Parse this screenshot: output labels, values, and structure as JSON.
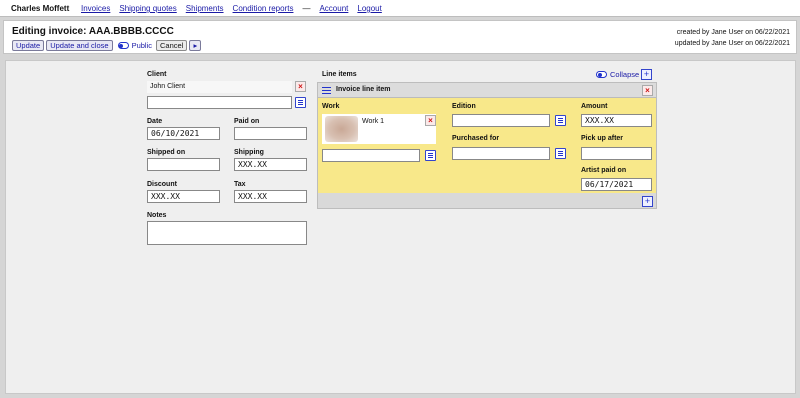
{
  "topbar": {
    "brand": "Charles Moffett",
    "nav": [
      "Invoices",
      "Shipping quotes",
      "Shipments",
      "Condition reports"
    ],
    "separator": "—",
    "nav_right": [
      "Account",
      "Logout"
    ]
  },
  "header": {
    "title": "Editing invoice: AAA.BBBB.CCCC",
    "buttons": {
      "update": "Update",
      "update_close": "Update and close",
      "public": "Public",
      "cancel": "Cancel",
      "arrow": "▸"
    },
    "created": "created by Jane User on 06/22/2021",
    "updated": "updated by Jane User on 06/22/2021"
  },
  "form": {
    "client_label": "Client",
    "client_value": "John Client",
    "client_search_value": "",
    "date_label": "Date",
    "date_value": "06/10/2021",
    "paid_on_label": "Paid on",
    "paid_on_value": "",
    "shipped_on_label": "Shipped on",
    "shipped_on_value": "",
    "shipping_label": "Shipping",
    "shipping_value": "XXX.XX",
    "discount_label": "Discount",
    "discount_value": "XXX.XX",
    "tax_label": "Tax",
    "tax_value": "XXX.XX",
    "notes_label": "Notes",
    "notes_value": ""
  },
  "line_items": {
    "label": "Line items",
    "collapse_label": "Collapse",
    "item_title": "Invoice line item",
    "work_label": "Work",
    "work_name": "Work 1",
    "edition_label": "Edition",
    "edition_value": "",
    "purchased_for_label": "Purchased for",
    "purchased_for_value": "",
    "amount_label": "Amount",
    "amount_value": "XXX.XX",
    "pick_up_after_label": "Pick up after",
    "pick_up_after_value": "",
    "artist_paid_on_label": "Artist paid on",
    "artist_paid_on_value": "06/17/2021"
  },
  "colors": {
    "link": "#1a1aa6",
    "accent": "#2233cc",
    "line_item_bg": "#f8e88a",
    "delete": "#cc1111"
  },
  "icons": {
    "remove": "close-icon",
    "choose": "list-icon",
    "add": "plus-icon",
    "drag": "drag-handle-icon",
    "toggle": "toggle-icon"
  }
}
